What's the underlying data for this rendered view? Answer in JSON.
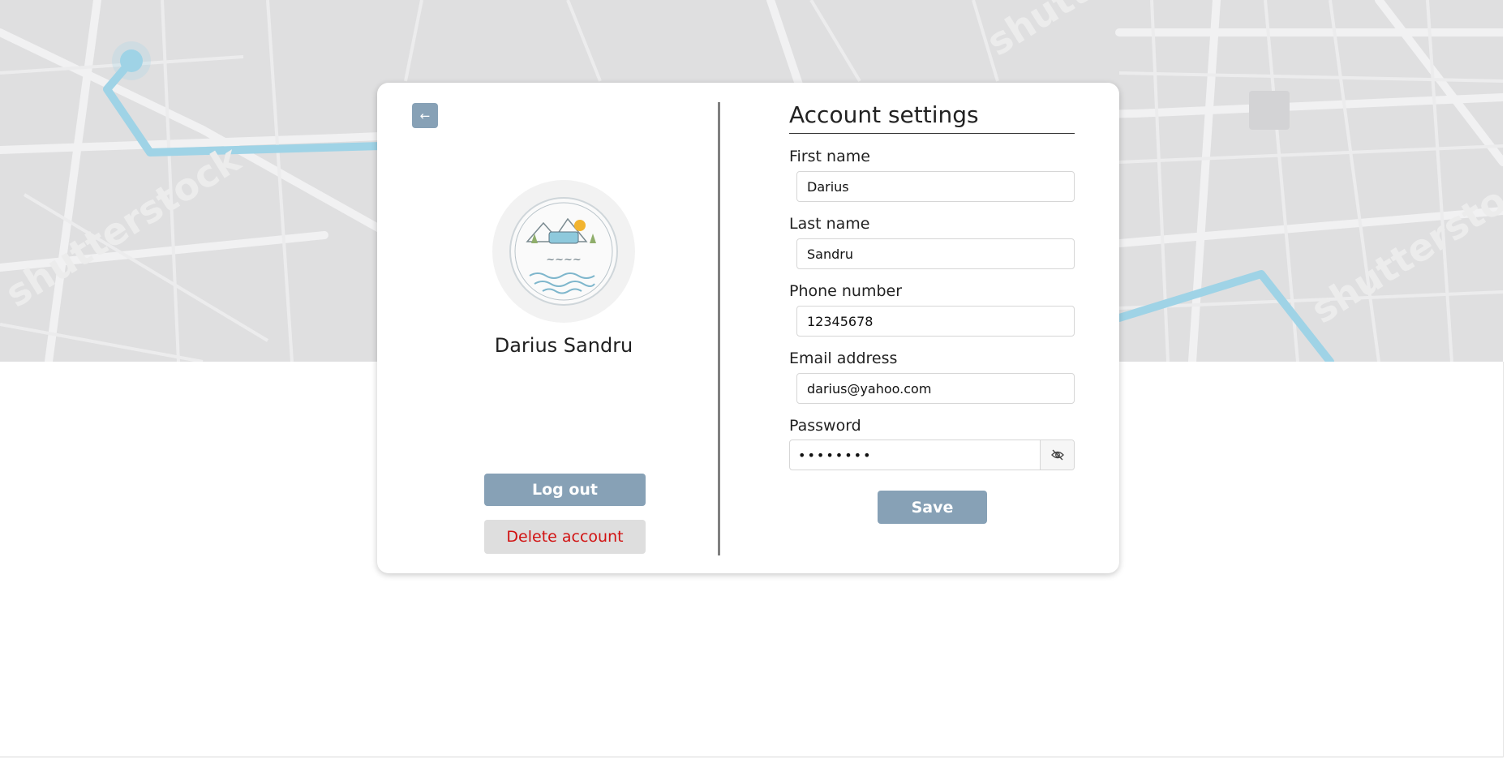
{
  "background": {
    "map_color": "#dfdfe0",
    "route_color": "#9fd3e6",
    "watermark": "shutterstock"
  },
  "profile": {
    "back_icon": "arrow-left-icon",
    "back_glyph": "←",
    "avatar_logo": "circular camping logo with mountains, van, sun and waves",
    "name": "Darius Sandru",
    "logout_label": "Log out",
    "delete_label": "Delete account"
  },
  "settings": {
    "title": "Account settings",
    "fields": {
      "first_name": {
        "label": "First name",
        "value": "Darius"
      },
      "last_name": {
        "label": "Last name",
        "value": "Sandru"
      },
      "phone": {
        "label": "Phone number",
        "value": "12345678"
      },
      "email": {
        "label": "Email address",
        "value": "darius@yahoo.com"
      },
      "password": {
        "label": "Password",
        "value": "••••••••",
        "toggle_icon": "eye-slash-icon"
      }
    },
    "save_label": "Save"
  },
  "colors": {
    "accent": "#87a1b6",
    "danger": "#d11212",
    "danger_bg": "#dedede"
  }
}
